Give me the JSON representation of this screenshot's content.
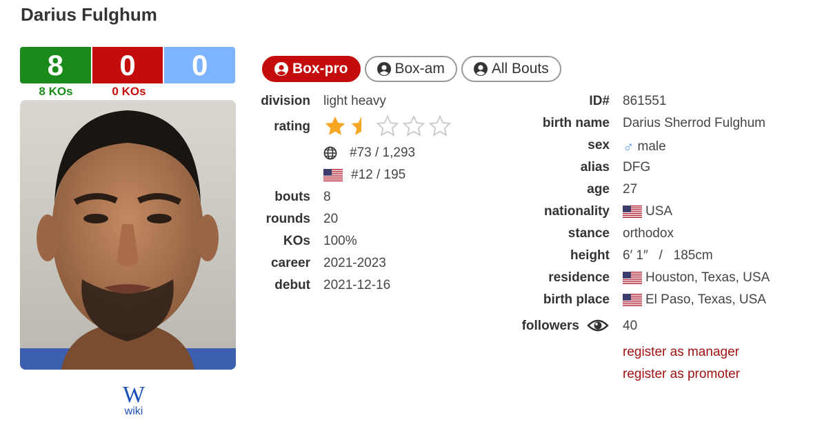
{
  "boxer": {
    "name": "Darius Fulghum"
  },
  "record": {
    "wins": "8",
    "losses": "0",
    "draws": "0",
    "wins_kos": "8 KOs",
    "losses_kos": "0 KOs"
  },
  "wiki": {
    "logo": "W",
    "label": "wiki"
  },
  "tabs": [
    {
      "label": "Box-pro",
      "icon": "user-circle-icon",
      "active": true
    },
    {
      "label": "Box-am",
      "icon": "user-circle-icon",
      "active": false
    },
    {
      "label": "All Bouts",
      "icon": "user-circle-icon",
      "active": false
    }
  ],
  "left_details": {
    "division_label": "division",
    "division": "light heavy",
    "rating_label": "rating",
    "rating_stars": 1.5,
    "rating_max": 5,
    "world_rank": "#73 / 1,293",
    "usa_rank": "#12 / 195",
    "bouts_label": "bouts",
    "bouts": "8",
    "rounds_label": "rounds",
    "rounds": "20",
    "kos_label": "KOs",
    "kos": "100%",
    "career_label": "career",
    "career": "2021-2023",
    "debut_label": "debut",
    "debut": "2021-12-16"
  },
  "right_details": {
    "id_label": "ID#",
    "id": "861551",
    "birth_name_label": "birth name",
    "birth_name": "Darius Sherrod Fulghum",
    "sex_label": "sex",
    "sex": "male",
    "sex_symbol": "♂",
    "alias_label": "alias",
    "alias": "DFG",
    "age_label": "age",
    "age": "27",
    "nationality_label": "nationality",
    "nationality": "USA",
    "stance_label": "stance",
    "stance": "orthodox",
    "height_label": "height",
    "height": "6′ 1″   /   185cm",
    "residence_label": "residence",
    "residence": "Houston, Texas, USA",
    "birth_place_label": "birth place",
    "birth_place": "El Paso, Texas, USA",
    "followers_label": "followers",
    "followers": "40"
  },
  "links": {
    "manager": "register as manager",
    "promoter": "register as promoter"
  },
  "colors": {
    "win": "#1a8a1a",
    "loss": "#c40c0c",
    "draw": "#7db3ff",
    "star": "#f5a623",
    "link": "#a01212"
  }
}
